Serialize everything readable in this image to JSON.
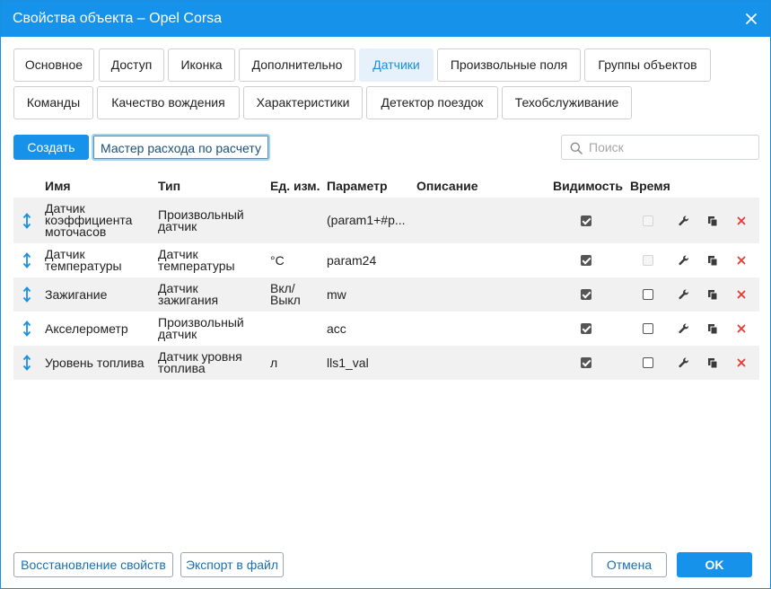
{
  "window": {
    "title": "Свойства объекта – Opel Corsa"
  },
  "tabs": [
    "Основное",
    "Доступ",
    "Иконка",
    "Дополнительно",
    "Датчики",
    "Произвольные поля",
    "Группы объектов",
    "Команды",
    "Качество вождения",
    "Характеристики",
    "Детектор поездок",
    "Техобслуживание"
  ],
  "active_tab": "Датчики",
  "toolbar": {
    "create_label": "Создать",
    "wizard_label": "Мастер расхода по расчету",
    "search_placeholder": "Поиск"
  },
  "table": {
    "headers": [
      "Имя",
      "Тип",
      "Ед. изм.",
      "Параметр",
      "Описание",
      "Видимость",
      "Время"
    ],
    "rows": [
      {
        "name": [
          "Датчик",
          "коэффициента",
          "моточасов"
        ],
        "type": [
          "Произвольный",
          "датчик"
        ],
        "unit": [
          ""
        ],
        "param": "(param1+#p...",
        "desc": "",
        "visible": true,
        "time": "disabled"
      },
      {
        "name": [
          "Датчик",
          "температуры"
        ],
        "type": [
          "Датчик",
          "температуры"
        ],
        "unit": [
          "°C"
        ],
        "param": "param24",
        "desc": "",
        "visible": true,
        "time": "disabled"
      },
      {
        "name": [
          "Зажигание"
        ],
        "type": [
          "Датчик",
          "зажигания"
        ],
        "unit": [
          "Вкл/",
          "Выкл"
        ],
        "param": "mw",
        "desc": "",
        "visible": true,
        "time": "off"
      },
      {
        "name": [
          "Акселерометр"
        ],
        "type": [
          "Произвольный",
          "датчик"
        ],
        "unit": [
          ""
        ],
        "param": "acc",
        "desc": "",
        "visible": true,
        "time": "off"
      },
      {
        "name": [
          "Уровень топлива"
        ],
        "type": [
          "Датчик уровня",
          "топлива"
        ],
        "unit": [
          "л"
        ],
        "param": "lls1_val",
        "desc": "",
        "visible": true,
        "time": "off"
      }
    ]
  },
  "footer": {
    "restore_label": "Восстановление свойств",
    "export_label": "Экспорт в файл",
    "cancel_label": "Отмена",
    "ok_label": "OK"
  },
  "colors": {
    "accent": "#1692ea",
    "active_tab_bg": "#e6f1fc",
    "delete": "#e53935",
    "row_shade": "#f1f1f1"
  },
  "icons": {
    "row_drag": "drag-updown-icon",
    "edit": "wrench-icon",
    "copy": "copy-icon",
    "delete": "delete-x-icon",
    "search": "search-icon",
    "close": "close-icon"
  }
}
